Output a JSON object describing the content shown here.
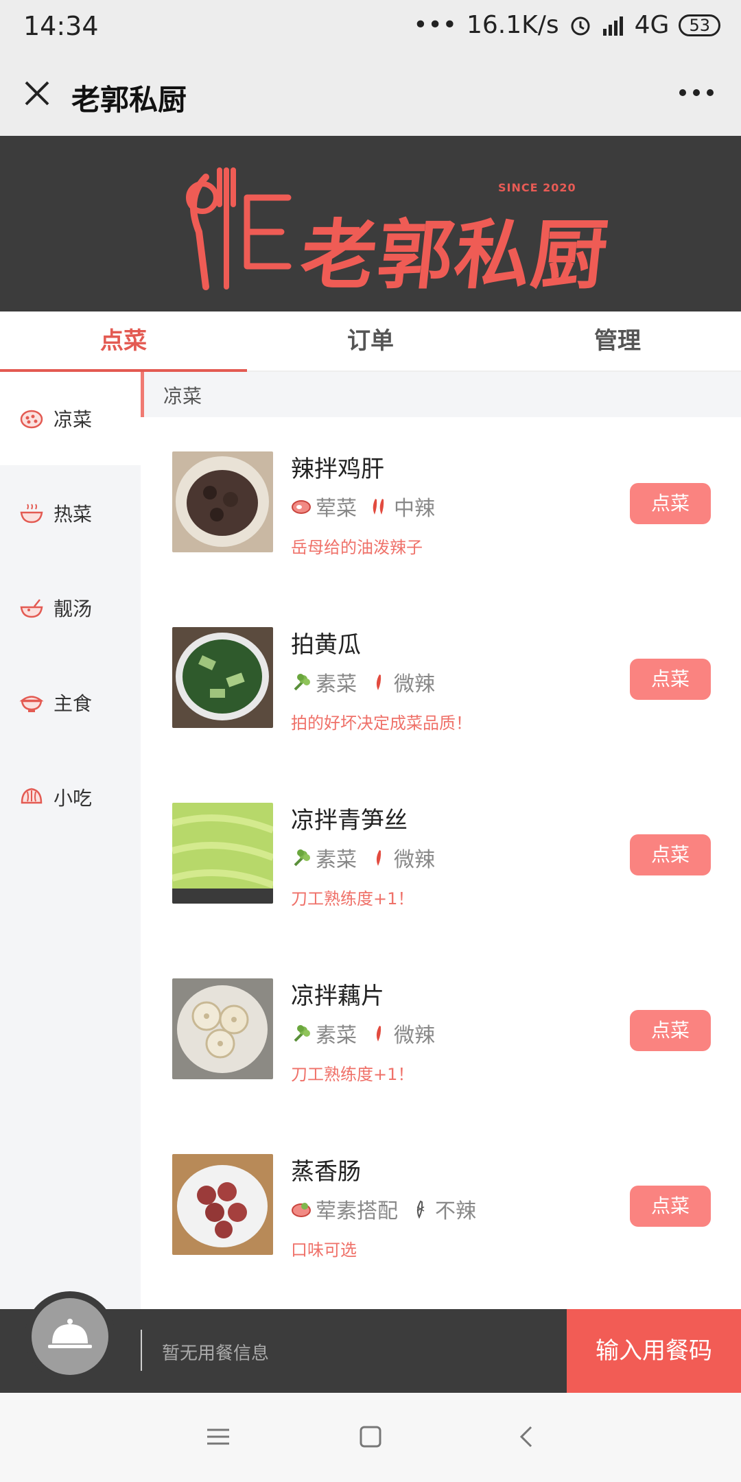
{
  "status_bar": {
    "time": "14:34",
    "network_speed": "16.1K/s",
    "signal": "4G",
    "battery": "53"
  },
  "title_bar": {
    "title": "老郭私厨"
  },
  "banner": {
    "since": "SINCE 2020",
    "brand": "老郭私厨"
  },
  "tabs": [
    {
      "label": "点菜",
      "active": true
    },
    {
      "label": "订单",
      "active": false
    },
    {
      "label": "管理",
      "active": false
    }
  ],
  "sidebar": {
    "items": [
      {
        "label": "凉菜",
        "icon": "cold-dish-icon",
        "active": true
      },
      {
        "label": "热菜",
        "icon": "hot-dish-icon",
        "active": false
      },
      {
        "label": "靓汤",
        "icon": "soup-icon",
        "active": false
      },
      {
        "label": "主食",
        "icon": "staple-icon",
        "active": false
      },
      {
        "label": "小吃",
        "icon": "snack-icon",
        "active": false
      }
    ]
  },
  "section": {
    "title": "凉菜"
  },
  "dishes": [
    {
      "name": "辣拌鸡肝",
      "type": "荤菜",
      "type_icon": "meat-icon",
      "spice": "中辣",
      "spice_icon": "double-chili-icon",
      "desc": "岳母给的油泼辣子",
      "button": "点菜"
    },
    {
      "name": "拍黄瓜",
      "type": "素菜",
      "type_icon": "vegetable-icon",
      "spice": "微辣",
      "spice_icon": "chili-icon",
      "desc": "拍的好坏决定成菜品质！",
      "button": "点菜"
    },
    {
      "name": "凉拌青笋丝",
      "type": "素菜",
      "type_icon": "vegetable-icon",
      "spice": "微辣",
      "spice_icon": "chili-icon",
      "desc": "刀工熟练度+1！",
      "button": "点菜"
    },
    {
      "name": "凉拌藕片",
      "type": "素菜",
      "type_icon": "vegetable-icon",
      "spice": "微辣",
      "spice_icon": "chili-icon",
      "desc": "刀工熟练度+1！",
      "button": "点菜"
    },
    {
      "name": "蒸香肠",
      "type": "荤素搭配",
      "type_icon": "mixed-icon",
      "spice": "不辣",
      "spice_icon": "no-chili-icon",
      "desc": "口味可选",
      "button": "点菜"
    }
  ],
  "bottom_bar": {
    "info": "暂无用餐信息",
    "cta": "输入用餐码"
  },
  "colors": {
    "accent": "#e35a52",
    "button": "#fa8380",
    "banner_bg": "#3c3c3c"
  }
}
